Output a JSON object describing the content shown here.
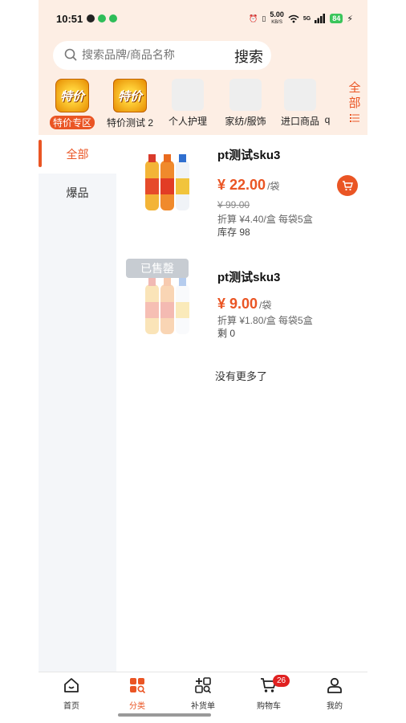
{
  "status_bar": {
    "time": "10:51",
    "net_speed": "5.00",
    "net_unit": "KB/S",
    "net_type": "5G",
    "battery": "84"
  },
  "search": {
    "placeholder": "搜索品牌/商品名称",
    "button_label": "搜索"
  },
  "categories": [
    {
      "label": "特价专区",
      "img_text": "特价"
    },
    {
      "label": "特价测试 2",
      "img_text": "特价"
    },
    {
      "label": "个人护理"
    },
    {
      "label": "家纺/服饰"
    },
    {
      "label": "进口商品"
    },
    {
      "label": "q"
    }
  ],
  "all_categories": {
    "line1": "全",
    "line2": "部"
  },
  "sidebar": {
    "items": [
      {
        "label": "全部"
      },
      {
        "label": "爆品"
      }
    ]
  },
  "products": [
    {
      "name": "pt测试sku3",
      "price": "¥ 22.00",
      "unit": "/袋",
      "original_price": "¥ 99.00",
      "detail": "折算 ¥4.40/盒   每袋5盒",
      "stock": "库存 98"
    },
    {
      "name": "pt测试sku3",
      "price": "¥ 9.00",
      "unit": "/袋",
      "sold_out": "已售罄",
      "detail": "折算 ¥1.80/盒   每袋5盒",
      "stock": "剩 0"
    }
  ],
  "no_more": "没有更多了",
  "tabbar": {
    "items": [
      {
        "label": "首页",
        "icon": "home-icon"
      },
      {
        "label": "分类",
        "icon": "category-icon"
      },
      {
        "label": "补货单",
        "icon": "restock-icon"
      },
      {
        "label": "购物车",
        "icon": "cart-icon"
      },
      {
        "label": "我的",
        "icon": "user-icon"
      }
    ],
    "cart_badge": "26"
  },
  "colors": {
    "accent": "#ea5524",
    "header_bg": "#fdeee4",
    "sidebar_bg": "#f4f6f9"
  }
}
